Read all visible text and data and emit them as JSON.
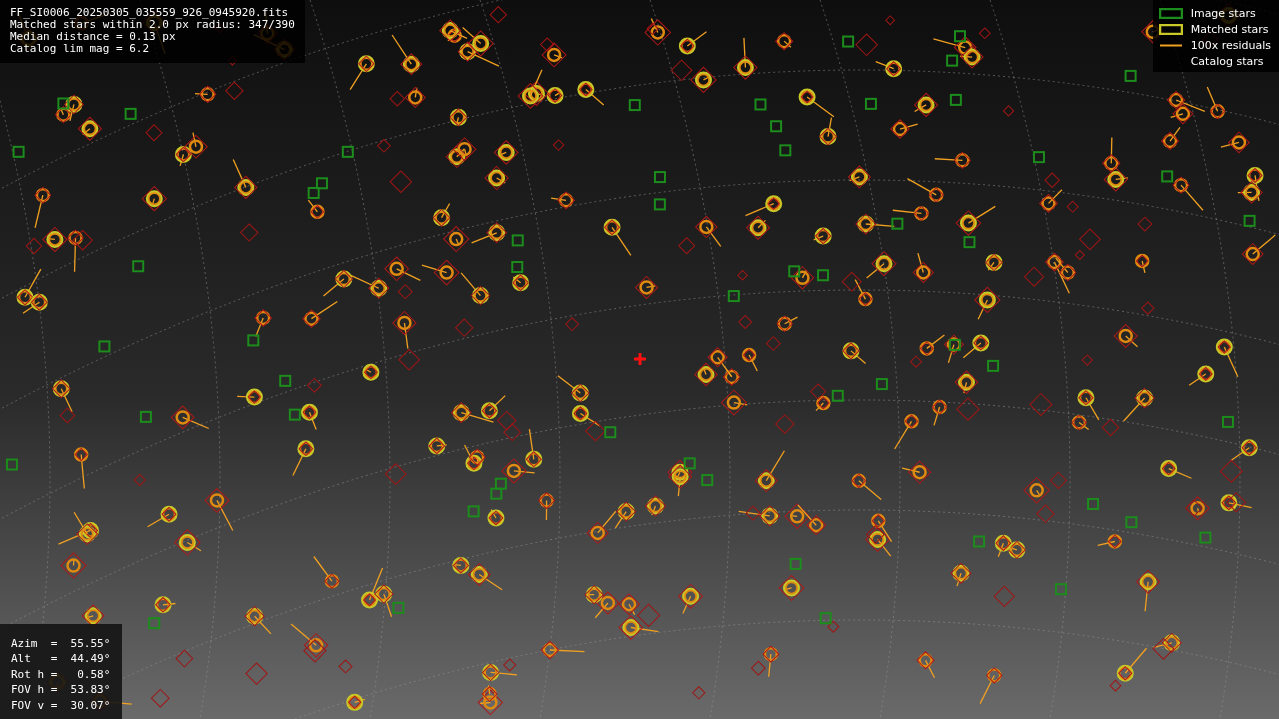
{
  "info": {
    "lines": [
      "FF_SI0006_20250305_035559_926_0945920.fits",
      "Matched stars within 2.0 px radius: 347/390",
      "Median distance = 0.13 px",
      "Catalog lim mag = 6.2"
    ]
  },
  "legend": [
    {
      "label": "Image stars",
      "kind": "box",
      "color": "#1c8c1c"
    },
    {
      "label": "Matched stars",
      "kind": "box",
      "color": "#c8c828"
    },
    {
      "label": "100x residuals",
      "kind": "line",
      "color": "#f0a020"
    },
    {
      "label": "Catalog stars",
      "kind": "blank"
    }
  ],
  "pointing": {
    "lines": [
      "Azim  =  55.55°",
      "Alt   =  44.49°",
      "Rot h =   0.58°",
      "FOV h =  53.83°",
      "FOV v =  30.07°"
    ]
  }
}
